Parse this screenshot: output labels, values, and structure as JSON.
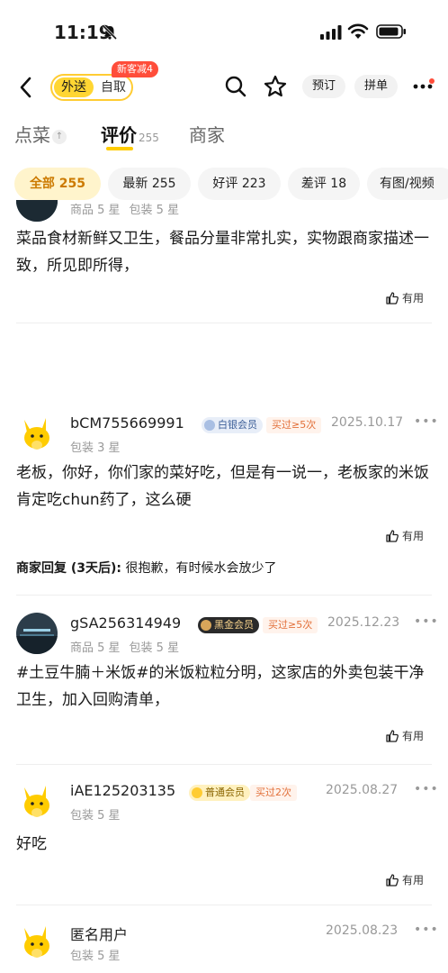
{
  "status_bar": {
    "time": "11:19"
  },
  "nav": {
    "mode_delivery": "外送",
    "mode_pickup": "自取",
    "new_customer_badge": "新客减4",
    "reserve_label": "预订",
    "group_label": "拼单"
  },
  "tabs": {
    "order": "点菜",
    "review": "评价",
    "review_count": "255",
    "merchant": "商家"
  },
  "filters": [
    {
      "label": "全部 255"
    },
    {
      "label": "最新 255"
    },
    {
      "label": "好评 223"
    },
    {
      "label": "差评 18"
    },
    {
      "label": "有图/视频"
    }
  ],
  "reviews": [
    {
      "ratings": [
        "商品 5 星",
        "包装 5 星"
      ],
      "text": "菜品食材新鲜又卫生，餐品分量非常扎实，实物跟商家描述一致，所见即所得，",
      "helpful": "有用"
    },
    {
      "username": "bCM755669991",
      "member_badge": "白银会员",
      "buy_badge": "买过≥5次",
      "date": "2025.10.17",
      "ratings": [
        "包装 3 星"
      ],
      "text": "老板，你好，你们家的菜好吃，但是有一说一，老板家的米饭肯定吃chun药了，这么硬",
      "helpful": "有用",
      "reply_label": "商家回复 (3天后):",
      "reply_text": "很抱歉，有时候水会放少了"
    },
    {
      "username": "gSA256314949",
      "member_badge": "黑金会员",
      "buy_badge": "买过≥5次",
      "date": "2025.12.23",
      "ratings": [
        "商品 5 星",
        "包装 5 星"
      ],
      "text": "#土豆牛腩＋米饭#的米饭粒粒分明，这家店的外卖包装干净卫生，加入回购清单，",
      "helpful": "有用"
    },
    {
      "username": "iAE125203135",
      "member_badge": "普通会员",
      "buy_badge": "买过2次",
      "date": "2025.08.27",
      "ratings": [
        "包装 5 星"
      ],
      "text": "好吃",
      "helpful": "有用"
    },
    {
      "username": "匿名用户",
      "date": "2025.08.23",
      "ratings": [
        "包装 5 星"
      ]
    }
  ],
  "colors": {
    "brand_yellow": "#ffd633",
    "active_chip_bg": "#fff4cc",
    "active_chip_text": "#cc7a00",
    "badge_red": "#ff4d3a"
  }
}
